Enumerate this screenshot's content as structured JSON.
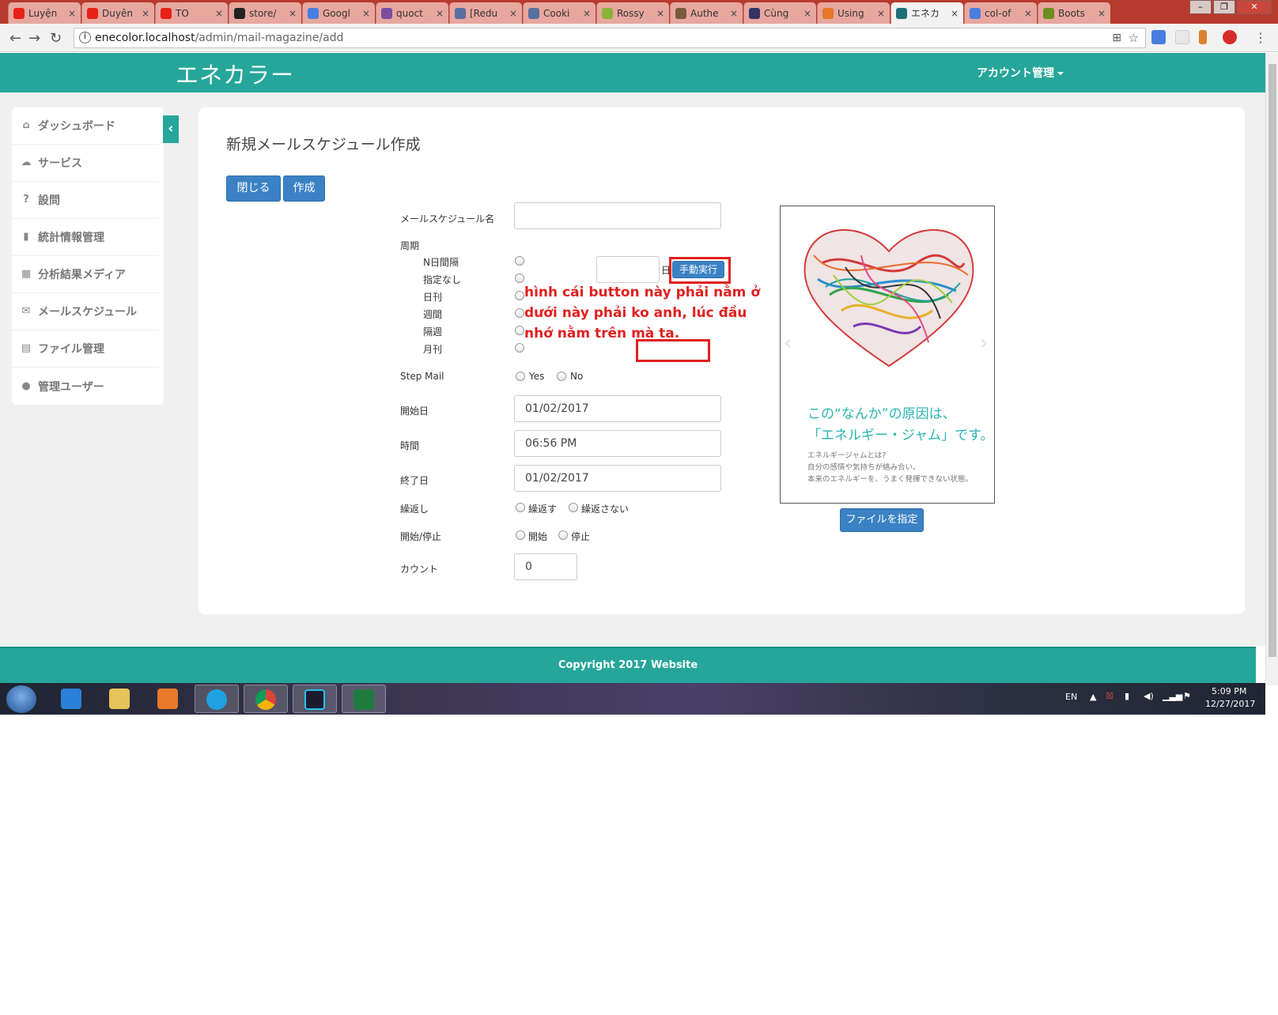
{
  "browser": {
    "tabs": [
      {
        "title": "Luyện",
        "fav": "#e62117"
      },
      {
        "title": "Duyên",
        "fav": "#e62117"
      },
      {
        "title": "TO",
        "fav": "#e62117"
      },
      {
        "title": "store/",
        "fav": "#222222"
      },
      {
        "title": "Googl",
        "fav": "#4a7de0"
      },
      {
        "title": "quoct",
        "fav": "#7a4ea0"
      },
      {
        "title": "[Redu",
        "fav": "#5a6fa0"
      },
      {
        "title": "Cooki",
        "fav": "#5a6fa0"
      },
      {
        "title": "Rossy",
        "fav": "#8bb33a"
      },
      {
        "title": "Authe",
        "fav": "#7a5a3a"
      },
      {
        "title": "Cùng",
        "fav": "#333366"
      },
      {
        "title": "Using",
        "fav": "#e8762b"
      },
      {
        "title": "エネカ",
        "fav": "#1f6f7a"
      },
      {
        "title": "col-of",
        "fav": "#4a7de0"
      },
      {
        "title": "Boots",
        "fav": "#6b8e23"
      }
    ],
    "url_host": "enecolor.localhost",
    "url_path": "/admin/mail-magazine/add"
  },
  "header": {
    "brand": "エネカラー",
    "account_menu": "アカウント管理"
  },
  "sidebar": {
    "items": [
      {
        "label": "ダッシュボード",
        "icon": "home-icon",
        "glyph": "⌂"
      },
      {
        "label": "サービス",
        "icon": "cloud-icon",
        "glyph": "☁"
      },
      {
        "label": "設問",
        "icon": "question-icon",
        "glyph": "?"
      },
      {
        "label": "統計情報管理",
        "icon": "bar-chart-icon",
        "glyph": "▮"
      },
      {
        "label": "分析結果メディア",
        "icon": "film-icon",
        "glyph": "▦"
      },
      {
        "label": "メールスケジュール",
        "icon": "envelope-icon",
        "glyph": "✉"
      },
      {
        "label": "ファイル管理",
        "icon": "file-icon",
        "glyph": "▤"
      },
      {
        "label": "管理ユーザー",
        "icon": "user-icon",
        "glyph": "●"
      }
    ]
  },
  "main": {
    "title": "新規メールスケジュール作成",
    "close_button": "閉じる",
    "create_button": "作成",
    "fields": {
      "schedule_name_label": "メールスケジュール名",
      "schedule_name_value": "",
      "cycle_label": "周期",
      "cycle_options": [
        "N日間隔",
        "指定なし",
        "日刊",
        "週間",
        "隔週",
        "月刊"
      ],
      "n_days_value": "",
      "n_days_suffix": "日",
      "manual_run_button": "手動実行",
      "step_mail_label": "Step Mail",
      "step_yes": "Yes",
      "step_no": "No",
      "start_date_label": "開始日",
      "start_date_value": "01/02/2017",
      "time_label": "時間",
      "time_value": "06:56 PM",
      "end_date_label": "終了日",
      "end_date_value": "01/02/2017",
      "repeat_label": "繰返し",
      "repeat_yes": "繰返す",
      "repeat_no": "繰返さない",
      "startstop_label": "開始/停止",
      "start_option": "開始",
      "stop_option": "停止",
      "count_label": "カウント",
      "count_value": "0"
    },
    "annotation": "hình cái button này phải nằm ở dưới này phải ko anh, lúc đầu nhớ nằm trên mà ta.",
    "preview": {
      "headline_1": "この“なんか”の原因は、",
      "headline_2": "「エネルギー・ジャム」です。",
      "body_1": "エネルギージャムとは?",
      "body_2": "自分の感情や気持ちが絡み合い、",
      "body_3": "本来のエネルギーを、うまく発揮できない状態。",
      "file_button": "ファイルを指定"
    }
  },
  "footer": {
    "copyright": "Copyright 2017 Website"
  },
  "taskbar": {
    "lang": "EN",
    "time": "5:09 PM",
    "date": "12/27/2017"
  },
  "colors": {
    "brand": "#26a69a",
    "primary_button": "#3b82c4",
    "annotation": "#e02020"
  }
}
